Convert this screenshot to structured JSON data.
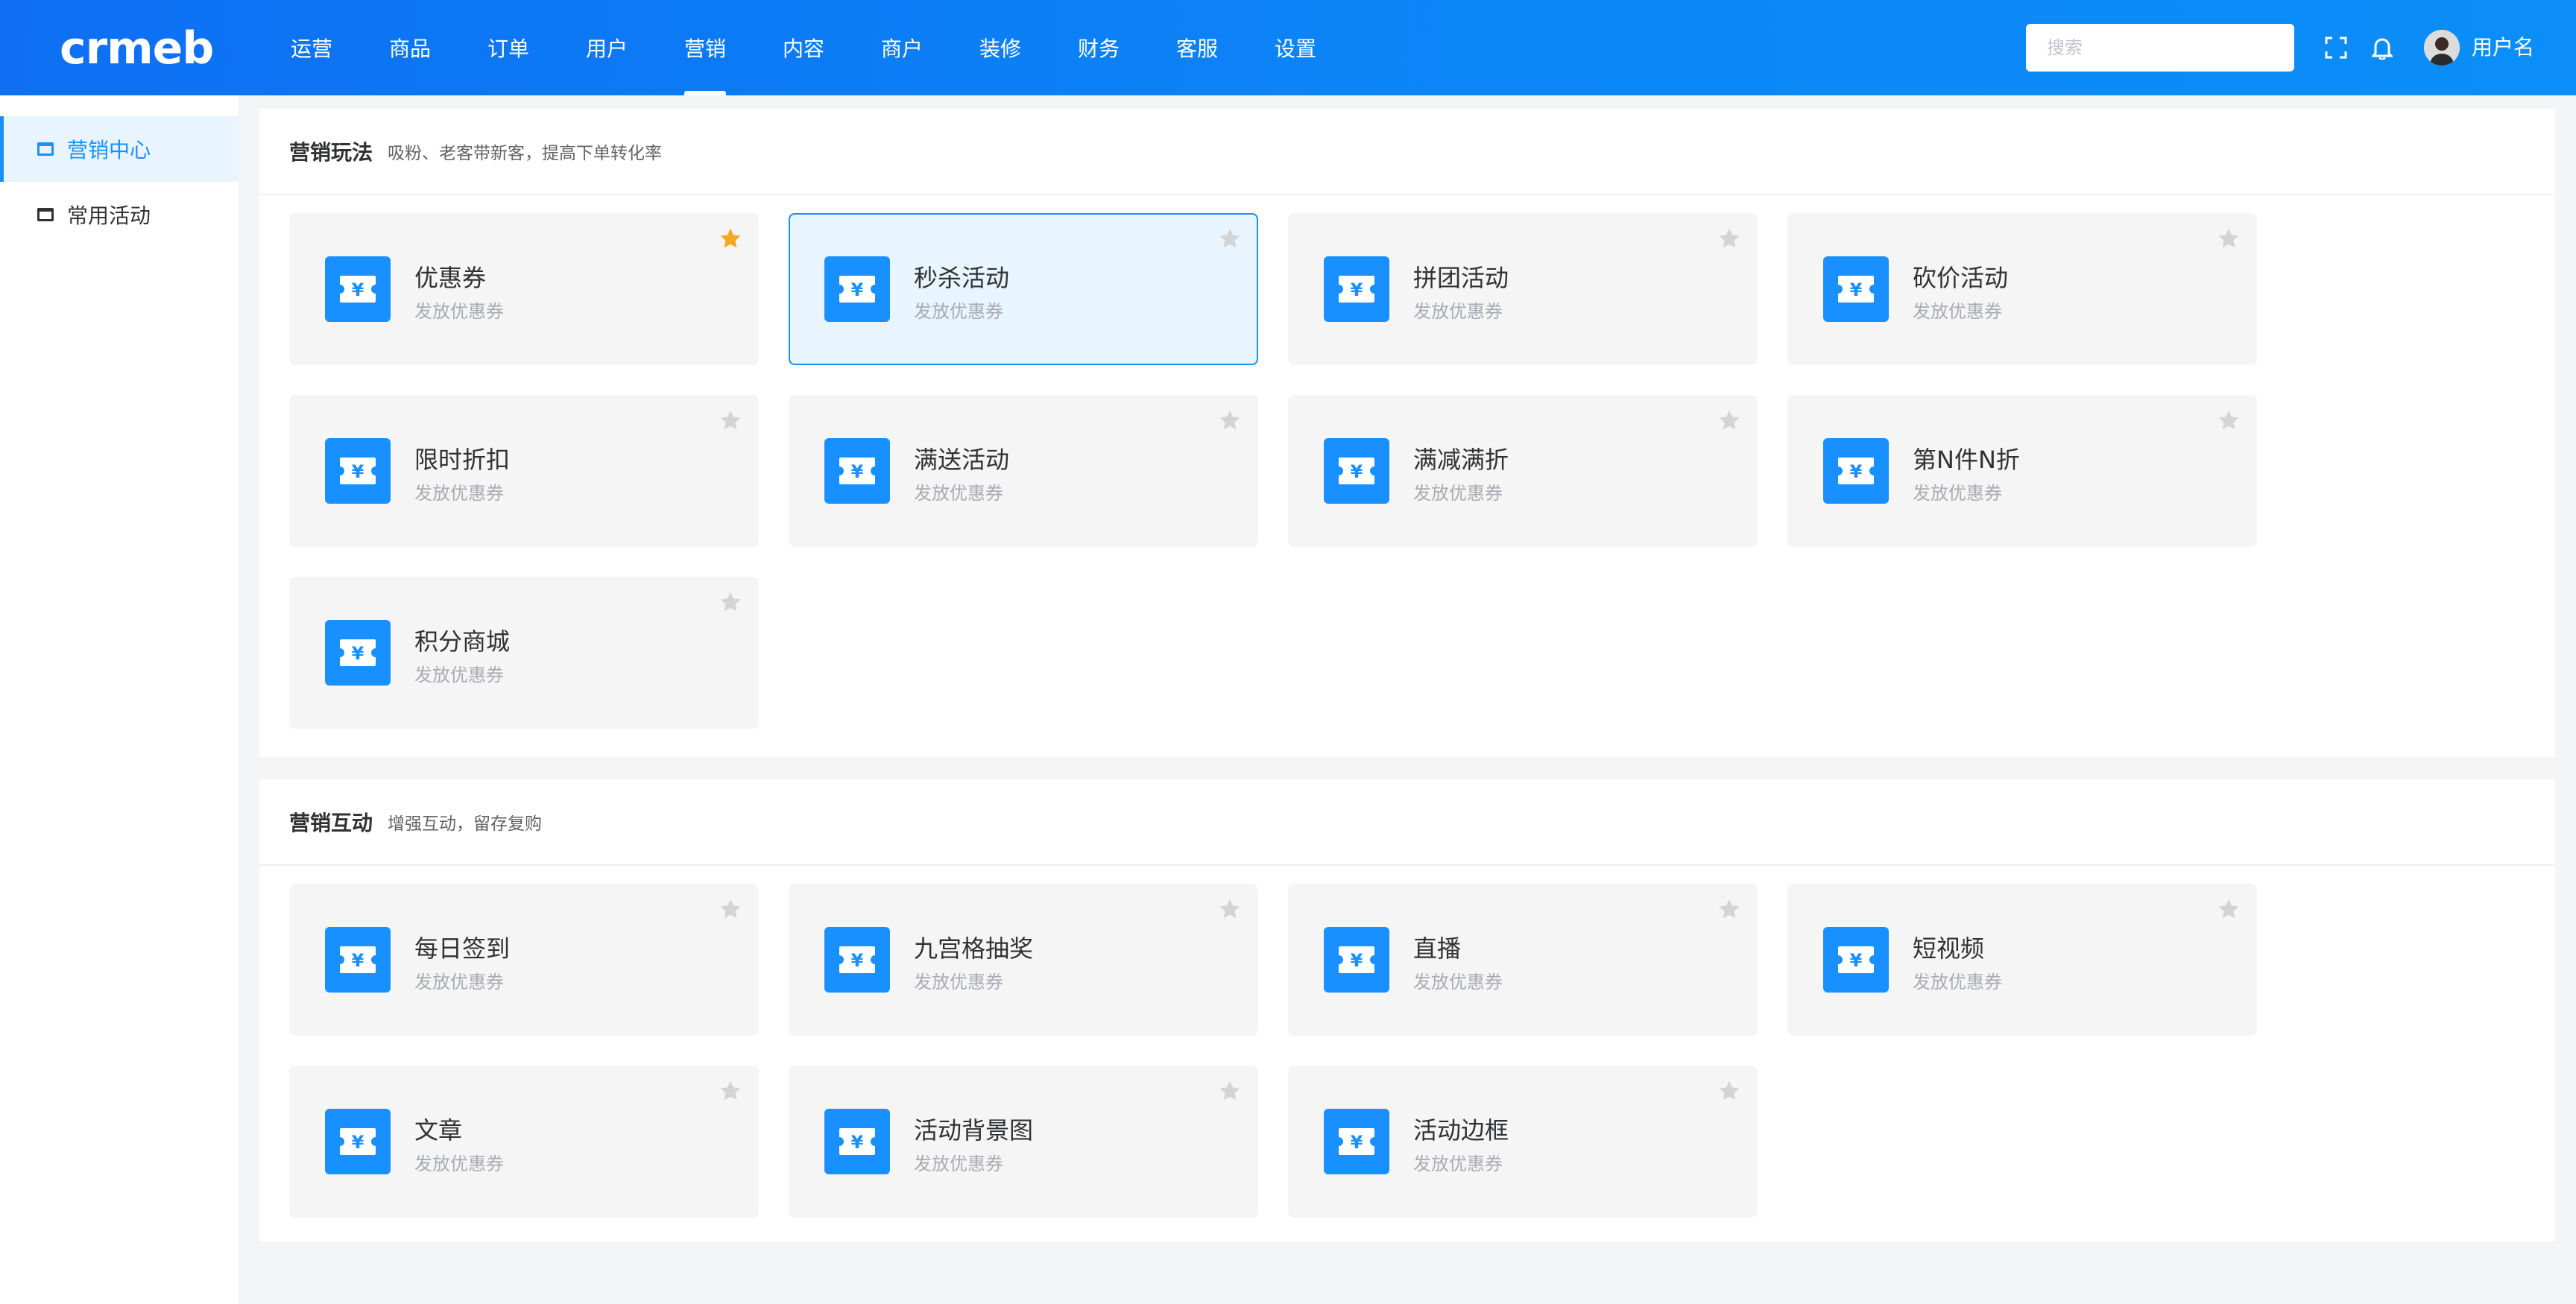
{
  "header": {
    "logo": "crmeb",
    "nav": [
      "运营",
      "商品",
      "订单",
      "用户",
      "营销",
      "内容",
      "商户",
      "装修",
      "财务",
      "客服",
      "设置"
    ],
    "active_nav": 4,
    "search_placeholder": "搜索",
    "username": "用户名"
  },
  "sidebar": {
    "items": [
      {
        "label": "营销中心",
        "active": true
      },
      {
        "label": "常用活动",
        "active": false
      }
    ]
  },
  "sections": [
    {
      "title": "营销玩法",
      "subtitle": "吸粉、老客带新客，提高下单转化率",
      "cards": [
        {
          "title": "优惠券",
          "desc": "发放优惠券",
          "starred": true,
          "selected": false
        },
        {
          "title": "秒杀活动",
          "desc": "发放优惠券",
          "starred": false,
          "selected": true
        },
        {
          "title": "拼团活动",
          "desc": "发放优惠券",
          "starred": false,
          "selected": false
        },
        {
          "title": "砍价活动",
          "desc": "发放优惠券",
          "starred": false,
          "selected": false
        },
        {
          "title": "限时折扣",
          "desc": "发放优惠券",
          "starred": false,
          "selected": false
        },
        {
          "title": "满送活动",
          "desc": "发放优惠券",
          "starred": false,
          "selected": false
        },
        {
          "title": "满减满折",
          "desc": "发放优惠券",
          "starred": false,
          "selected": false
        },
        {
          "title": "第N件N折",
          "desc": "发放优惠券",
          "starred": false,
          "selected": false
        },
        {
          "title": "积分商城",
          "desc": "发放优惠券",
          "starred": false,
          "selected": false
        }
      ]
    },
    {
      "title": "营销互动",
      "subtitle": "增强互动，留存复购",
      "cards": [
        {
          "title": "每日签到",
          "desc": "发放优惠券",
          "starred": false,
          "selected": false
        },
        {
          "title": "九宫格抽奖",
          "desc": "发放优惠券",
          "starred": false,
          "selected": false
        },
        {
          "title": "直播",
          "desc": "发放优惠券",
          "starred": false,
          "selected": false
        },
        {
          "title": "短视频",
          "desc": "发放优惠券",
          "starred": false,
          "selected": false
        },
        {
          "title": "文章",
          "desc": "发放优惠券",
          "starred": false,
          "selected": false
        },
        {
          "title": "活动背景图",
          "desc": "发放优惠券",
          "starred": false,
          "selected": false
        },
        {
          "title": "活动边框",
          "desc": "发放优惠券",
          "starred": false,
          "selected": false
        }
      ]
    }
  ],
  "colors": {
    "accent": "#1890ff",
    "star_active": "#f5a623",
    "star_inactive": "#d3d4d6",
    "card_bg": "#f5f5f5"
  },
  "icons": {
    "card": "coupon-yen-icon",
    "star": "star-icon",
    "fullscreen": "fullscreen-icon",
    "bell": "bell-icon"
  }
}
